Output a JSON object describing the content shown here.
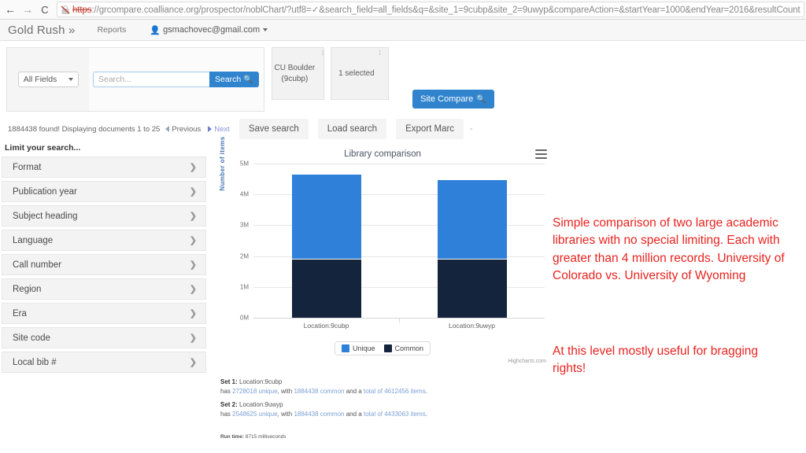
{
  "browser": {
    "back_icon": "back-arrow-icon",
    "forward_icon": "forward-arrow-icon",
    "reload_icon": "reload-icon",
    "security_icon": "broken-lock-icon",
    "url_scheme": "https",
    "url_rest": "://grcompare.coalliance.org/prospector/noblChart/?utf8=✓&search_field=all_fields&q=&site_1=9cubp&site_2=9uwyp&compareAction=&startYear=1000&endYear=2016&resultCount",
    "url_host": "grcompare.coalliance.org"
  },
  "app_header": {
    "brand": "Gold Rush »",
    "nav_reports": "Reports",
    "user_email": "gsmachovec@gmail.com",
    "person_icon": "person-icon",
    "caret_icon": "caret-down-icon"
  },
  "toolbar": {
    "field_select_value": "All Fields",
    "search_placeholder": "Search...",
    "search_value": "",
    "search_button": "Search",
    "search_icon": "magnifier-icon",
    "site_1": "CU Boulder (9cubp)",
    "site_2": "1 selected",
    "sort_mark": "⁞",
    "site_compare_button": "Site Compare"
  },
  "results_bar": {
    "count_text": "1884438 found! Displaying documents 1 to 25",
    "previous": "Previous",
    "next": "Next",
    "save_search": "Save search",
    "load_search": "Load search",
    "export_marc": "Export Marc",
    "trailing_dash": "-"
  },
  "sidebar": {
    "title": "Limit your search...",
    "chevron_icon": "chevron-right-icon",
    "facets": [
      {
        "label": "Format"
      },
      {
        "label": "Publication year"
      },
      {
        "label": "Subject heading"
      },
      {
        "label": "Language"
      },
      {
        "label": "Call number"
      },
      {
        "label": "Region"
      },
      {
        "label": "Era"
      },
      {
        "label": "Site code"
      },
      {
        "label": "Local bib #"
      }
    ]
  },
  "chart_data": {
    "type": "bar",
    "stacked": true,
    "title": "Library comparison",
    "xlabel": "",
    "ylabel": "Number of items",
    "categories": [
      "Location:9cubp",
      "Location:9uwyp"
    ],
    "series": [
      {
        "name": "Common",
        "color": "#14243d",
        "values": [
          1884438,
          1884438
        ]
      },
      {
        "name": "Unique",
        "color": "#2f80d8",
        "values": [
          2728018,
          2548625
        ]
      }
    ],
    "totals": [
      4612456,
      4433063
    ],
    "ylim": [
      0,
      5000000
    ],
    "yticks": [
      "0M",
      "1M",
      "2M",
      "3M",
      "4M",
      "5M"
    ],
    "ytick_values": [
      0,
      1000000,
      2000000,
      3000000,
      4000000,
      5000000
    ],
    "grid": true,
    "legend_position": "bottom",
    "credits": "Highcharts.com",
    "menu_icon": "hamburger-menu-icon"
  },
  "summary": {
    "set1_label": "Set 1:",
    "set1_location": "Location:9cubp",
    "set1_has": "has",
    "set1_unique": "2728018 unique",
    "set1_with": ", with",
    "set1_common": "1884438 common",
    "set1_and": "and a",
    "set1_total": "total of 4612456 items",
    "set1_period": ".",
    "set2_label": "Set 2:",
    "set2_location": "Location:9uwyp",
    "set2_has": "has",
    "set2_unique": "2548625 unique",
    "set2_with": ", with",
    "set2_common": "1884438 common",
    "set2_and": "and a",
    "set2_total": "total of 4433063 items",
    "set2_period": ".",
    "runtime_label": "Run time:",
    "runtime_value": "8715 milliseconds"
  },
  "annotations": {
    "main": "Simple comparison of two large academic libraries with no special limiting.  Each with greater than 4 million records.  University of Colorado vs. University of Wyoming",
    "second": "At this level mostly useful for bragging rights!",
    "color": "#e8231f"
  }
}
